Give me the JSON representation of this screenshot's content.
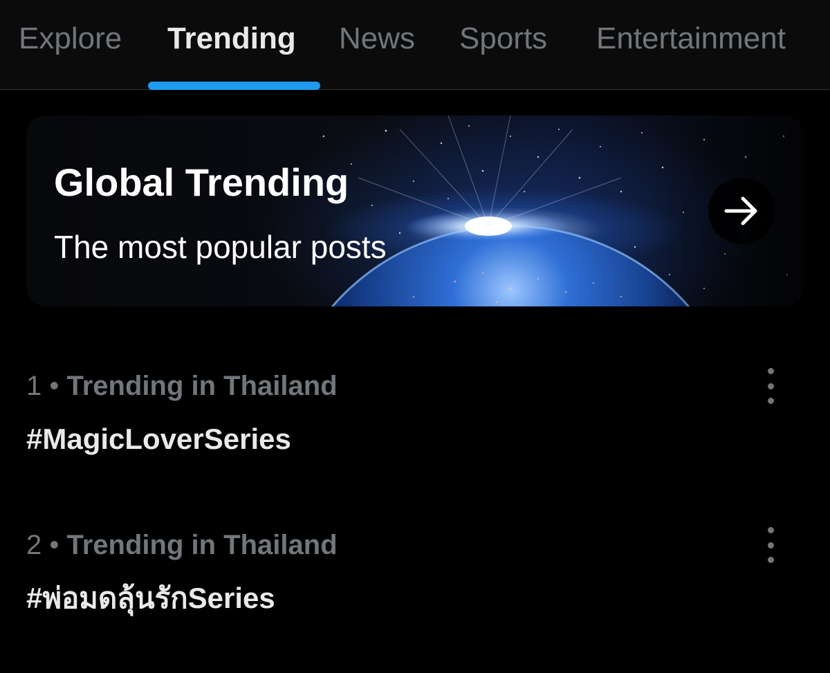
{
  "tabs": [
    {
      "label": "Explore",
      "active": false
    },
    {
      "label": "Trending",
      "active": true
    },
    {
      "label": "News",
      "active": false
    },
    {
      "label": "Sports",
      "active": false
    },
    {
      "label": "Entertainment",
      "active": false
    }
  ],
  "colors": {
    "background": "#000000",
    "accent": "#1d9bf0",
    "primary_text": "#e7e9ea",
    "secondary_text": "#71767b"
  },
  "banner": {
    "title": "Global Trending",
    "subtitle": "The most popular posts",
    "arrow_icon": "arrow-right-icon",
    "image": "earth-from-space-sunrise"
  },
  "trends": [
    {
      "rank": "1",
      "separator": "•",
      "context": "Trending in Thailand",
      "name": "#MagicLoverSeries",
      "menu_icon": "more-vertical-icon"
    },
    {
      "rank": "2",
      "separator": "•",
      "context": "Trending in Thailand",
      "name": "#พ่อมดลุ้นรักSeries",
      "menu_icon": "more-vertical-icon"
    }
  ]
}
